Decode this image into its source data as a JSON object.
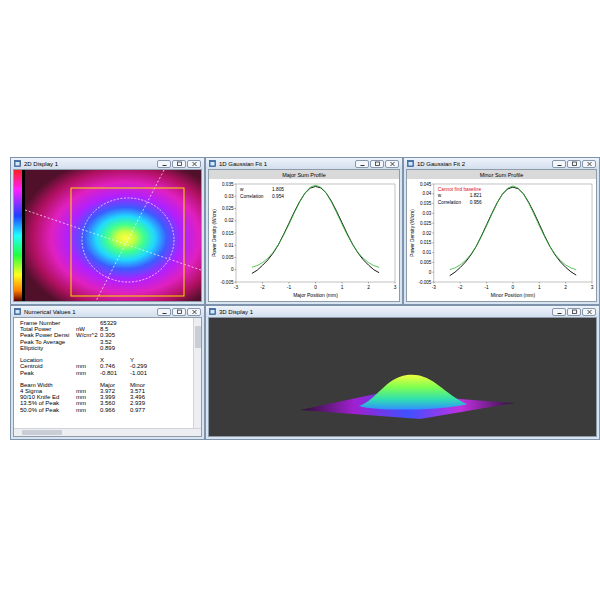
{
  "windows": {
    "display2d": {
      "title": "2D Display 1"
    },
    "fit1": {
      "title": "1D Gaussian Fit 1",
      "chart": {
        "title": "Major Sum Profile",
        "y_label": "Power Density (W/cm)",
        "x_label": "Major Position (mm)",
        "y_ticks": [
          "0.035",
          "0.03",
          "0.025",
          "0.02",
          "0.015",
          "0.01",
          "0.005",
          "0",
          "-0.005"
        ],
        "x_ticks": [
          "-3",
          "-2",
          "-1",
          "0",
          "1",
          "2",
          "3"
        ],
        "legend": [
          {
            "label": "w",
            "value": "1.805"
          },
          {
            "label": "Correlation",
            "value": "0.954"
          }
        ],
        "series": [
          {
            "color": "#000000",
            "x": [
              -2.4,
              -2.2,
              -2.0,
              -1.8,
              -1.6,
              -1.4,
              -1.2,
              -1.0,
              -0.8,
              -0.6,
              -0.4,
              -0.2,
              0,
              0.2,
              0.4,
              0.6,
              0.8,
              1.0,
              1.2,
              1.4,
              1.6,
              1.8,
              2.0,
              2.2,
              2.4
            ],
            "y": [
              -0.0015,
              -0.0002,
              0.0018,
              0.004,
              0.0068,
              0.0102,
              0.0145,
              0.019,
              0.0236,
              0.0278,
              0.0312,
              0.0333,
              0.034,
              0.0334,
              0.0314,
              0.028,
              0.0238,
              0.0192,
              0.0146,
              0.0104,
              0.0069,
              0.0041,
              0.0019,
              0,
              -0.0012
            ]
          },
          {
            "color": "#2fb52f",
            "x": [
              -2.4,
              -2.2,
              -2.0,
              -1.8,
              -1.6,
              -1.4,
              -1.2,
              -1.0,
              -0.8,
              -0.6,
              -0.4,
              -0.2,
              0,
              0.2,
              0.4,
              0.6,
              0.8,
              1.0,
              1.2,
              1.4,
              1.6,
              1.8,
              2.0,
              2.2,
              2.4
            ],
            "y": [
              0.001,
              0.0017,
              0.0029,
              0.0047,
              0.0071,
              0.0103,
              0.0142,
              0.0186,
              0.0232,
              0.0276,
              0.0313,
              0.0337,
              0.0345,
              0.0337,
              0.0313,
              0.0276,
              0.0232,
              0.0186,
              0.0142,
              0.0103,
              0.0071,
              0.0047,
              0.0029,
              0.0017,
              0.001
            ]
          }
        ]
      }
    },
    "fit2": {
      "title": "1D Gaussian Fit 2",
      "chart": {
        "title": "Minor Sum Profile",
        "y_label": "Power Density (W/cm)",
        "x_label": "Minor Position (mm)",
        "warning": "Cannot find baseline",
        "y_ticks": [
          "0.045",
          "0.04",
          "0.035",
          "0.03",
          "0.025",
          "0.02",
          "0.015",
          "0.01",
          "0.005",
          "0",
          "-0.005"
        ],
        "x_ticks": [
          "-3",
          "-2",
          "-1",
          "0",
          "1",
          "2",
          "3"
        ],
        "legend": [
          {
            "label": "w",
            "value": "1.821"
          },
          {
            "label": "Correlation",
            "value": "0.956"
          }
        ],
        "series": [
          {
            "color": "#000000",
            "x": [
              -2.4,
              -2.2,
              -2.0,
              -1.8,
              -1.6,
              -1.4,
              -1.2,
              -1.0,
              -0.8,
              -0.6,
              -0.4,
              -0.2,
              0,
              0.2,
              0.4,
              0.6,
              0.8,
              1.0,
              1.2,
              1.4,
              1.6,
              1.8,
              2.0,
              2.2,
              2.4
            ],
            "y": [
              -0.0018,
              0,
              0.0024,
              0.0052,
              0.0087,
              0.013,
              0.0184,
              0.0242,
              0.03,
              0.0354,
              0.0398,
              0.0425,
              0.0434,
              0.0426,
              0.04,
              0.0356,
              0.0303,
              0.0245,
              0.0186,
              0.0132,
              0.0088,
              0.0053,
              0.0025,
              0.0002,
              -0.0015
            ]
          },
          {
            "color": "#2fb52f",
            "x": [
              -2.4,
              -2.2,
              -2.0,
              -1.8,
              -1.6,
              -1.4,
              -1.2,
              -1.0,
              -0.8,
              -0.6,
              -0.4,
              -0.2,
              0,
              0.2,
              0.4,
              0.6,
              0.8,
              1.0,
              1.2,
              1.4,
              1.6,
              1.8,
              2.0,
              2.2,
              2.4
            ],
            "y": [
              0.0013,
              0.0022,
              0.0037,
              0.006,
              0.0091,
              0.0131,
              0.0181,
              0.0237,
              0.0296,
              0.0352,
              0.0399,
              0.0429,
              0.044,
              0.0429,
              0.0399,
              0.0352,
              0.0296,
              0.0237,
              0.0181,
              0.0131,
              0.0091,
              0.006,
              0.0037,
              0.0022,
              0.0013
            ]
          }
        ]
      }
    },
    "numerical": {
      "title": "Numerical Values 1",
      "rows": [
        {
          "cells": [
            "Frame Number",
            "",
            "65329",
            ""
          ]
        },
        {
          "cells": [
            "Total Power",
            "nW",
            "8.5",
            ""
          ]
        },
        {
          "cells": [
            "Peak Power Densi",
            "W/cm^2",
            "0.305",
            ""
          ]
        },
        {
          "cells": [
            "Peak To Average",
            "",
            "3.52",
            ""
          ]
        },
        {
          "cells": [
            "Ellipticity",
            "",
            "0.899",
            ""
          ]
        },
        {
          "cells": [
            "",
            "",
            "",
            ""
          ]
        },
        {
          "cells": [
            "Location",
            "",
            "X",
            "Y"
          ]
        },
        {
          "cells": [
            "Centroid",
            "mm",
            "0.746",
            "-0.299"
          ]
        },
        {
          "cells": [
            "Peak",
            "mm",
            "-0.801",
            "-1.001"
          ]
        },
        {
          "cells": [
            "",
            "",
            "",
            ""
          ]
        },
        {
          "cells": [
            "Beam Width",
            "",
            "Major",
            "Minor"
          ]
        },
        {
          "cells": [
            "4 Sigma",
            "mm",
            "3.972",
            "3.571"
          ]
        },
        {
          "cells": [
            "90/10 Knife Ed",
            "mm",
            "3.999",
            "3.496"
          ]
        },
        {
          "cells": [
            "13.5% of Peak",
            "mm",
            "3.560",
            "2.939"
          ]
        },
        {
          "cells": [
            "50.0% of Peak",
            "mm",
            "0.966",
            "0.977"
          ]
        }
      ]
    },
    "display3d": {
      "title": "3D Display 1"
    }
  }
}
